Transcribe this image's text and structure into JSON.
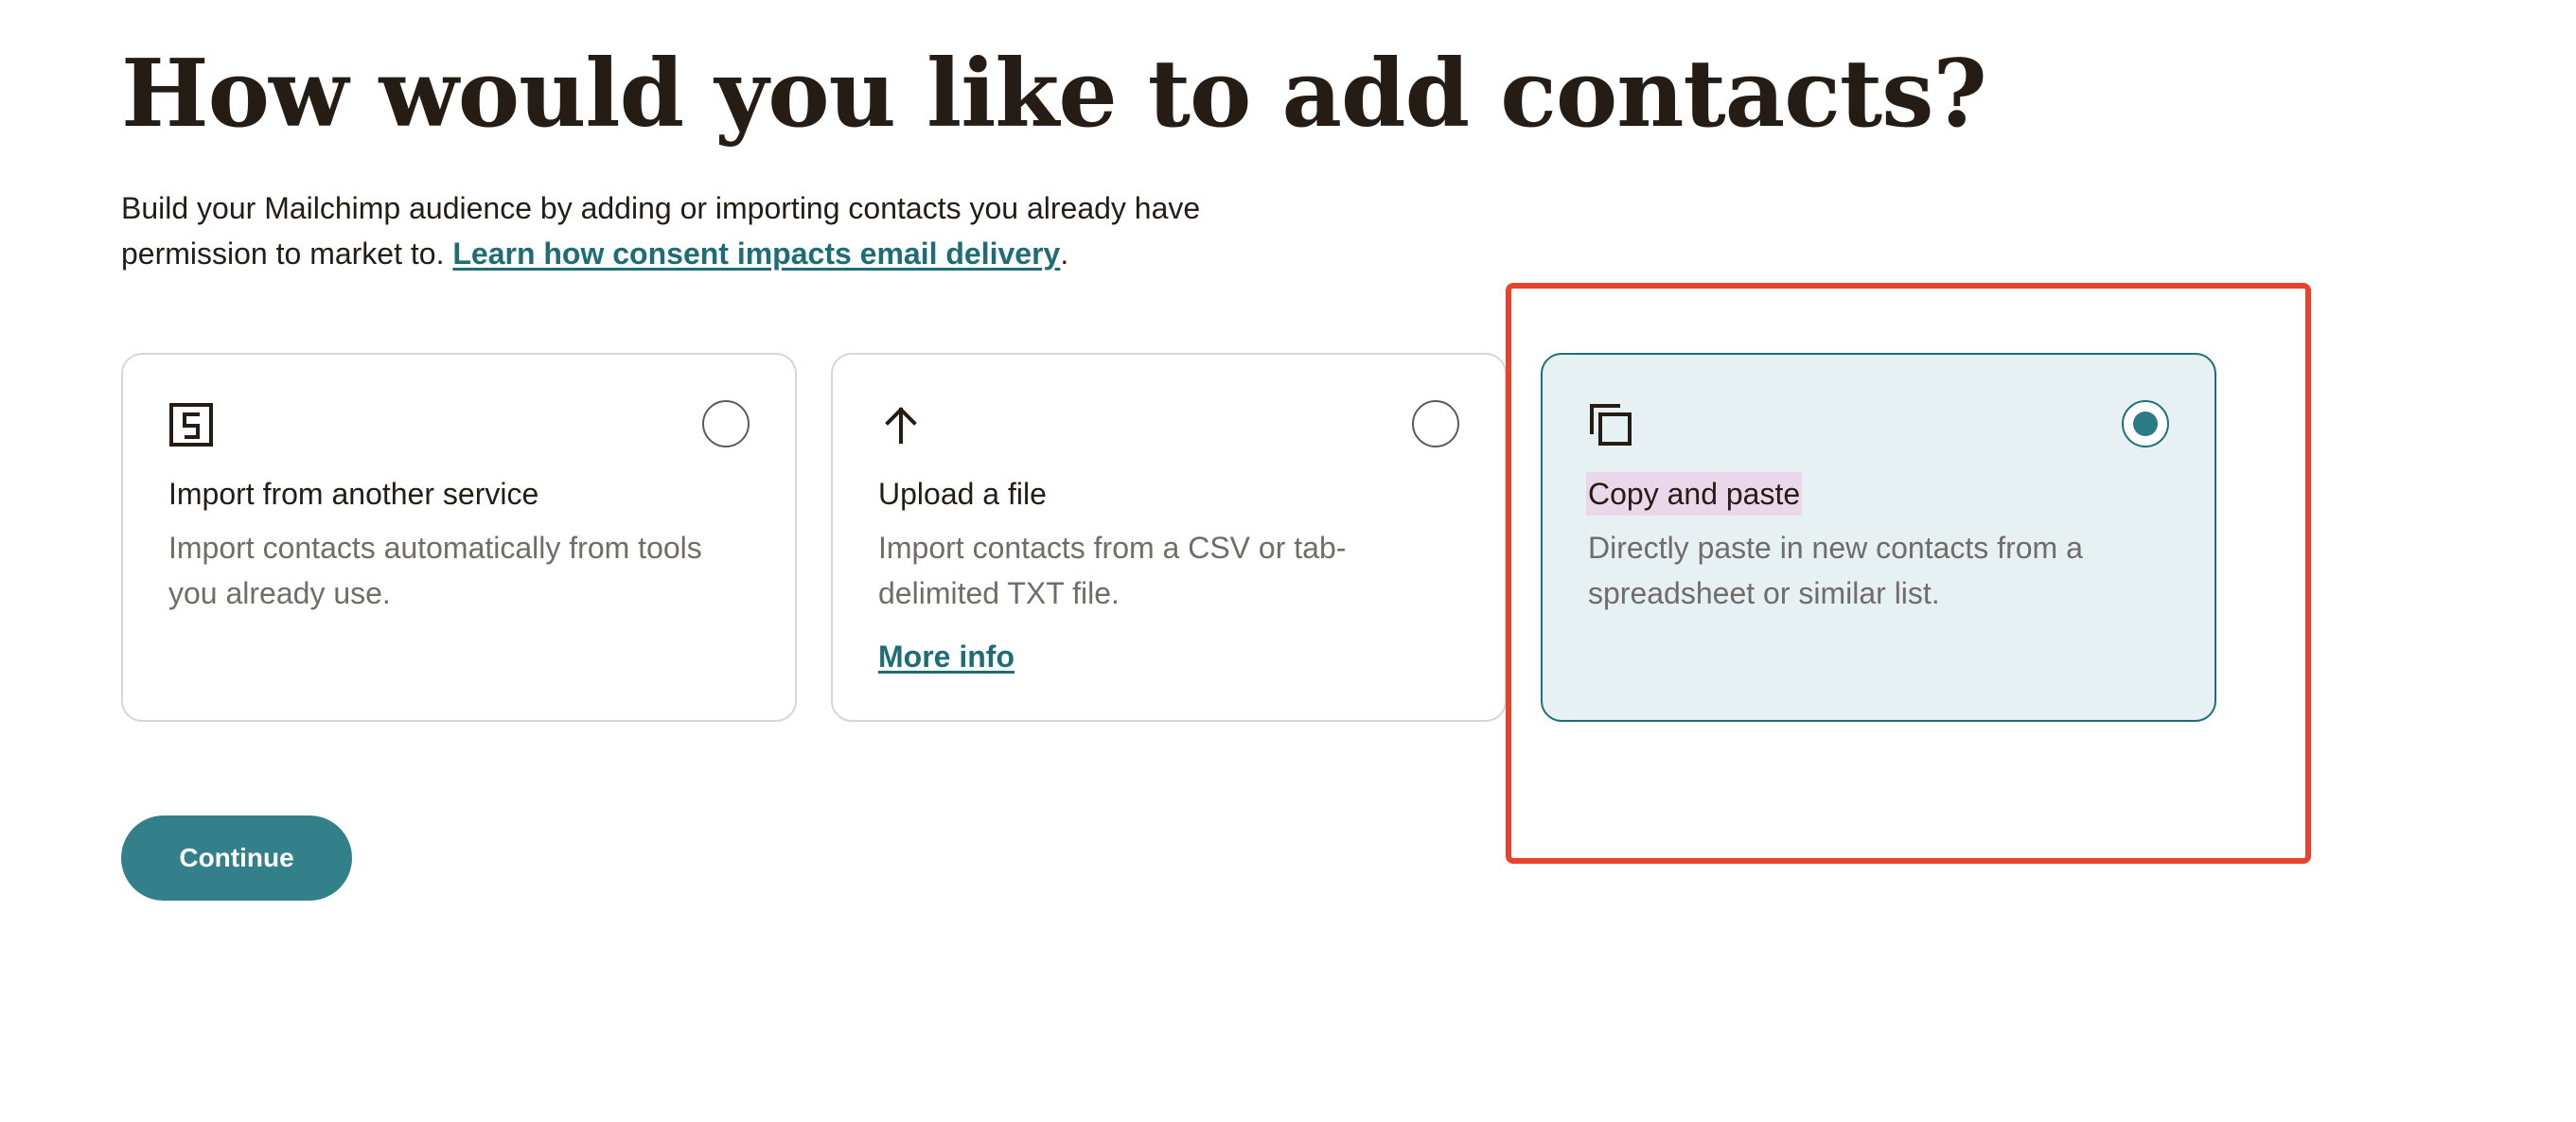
{
  "page": {
    "title": "How would you like to add contacts?",
    "intro_text": "Build your Mailchimp audience by adding or importing contacts you already have permission to market to. ",
    "intro_link": "Learn how consent impacts email delivery",
    "intro_suffix": "."
  },
  "options": [
    {
      "icon": "import-service-icon",
      "title": "Import from another service",
      "description": "Import contacts automatically from tools you already use.",
      "selected": false
    },
    {
      "icon": "arrow-up-icon",
      "title": "Upload a file",
      "description": "Import contacts from a CSV or tab-delimited TXT file.",
      "link": "More info",
      "selected": false
    },
    {
      "icon": "copy-icon",
      "title": "Copy and paste",
      "description": "Directly paste in new contacts from a spreadsheet or similar list.",
      "selected": true
    }
  ],
  "actions": {
    "continue_label": "Continue"
  },
  "colors": {
    "accent": "#33808a",
    "link": "#1e6c75",
    "selected_card_bg": "#e7f0f3",
    "highlight": "#e8412c"
  }
}
